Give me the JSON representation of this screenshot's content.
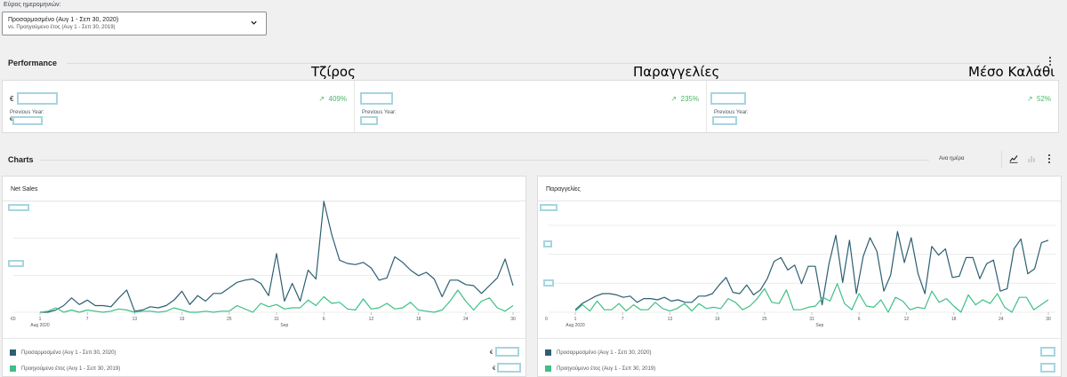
{
  "date_range": {
    "label": "Εύρος ημερομηνιών:",
    "primary": "Προσαρμοσμένο (Αυγ 1 - Σεπ 30, 2020)",
    "secondary": "vs. Προηγούμενο έτος (Αυγ 1 - Σεπ 30, 2019)",
    "icon": "chevron-down-icon"
  },
  "performance": {
    "title": "Performance",
    "menu_icon": "kebab-menu-icon",
    "overlays": [
      "Τζίρος",
      "Παραγγελίες",
      "Μέσο Καλάθι"
    ],
    "cards": [
      {
        "currency": "€",
        "delta": "409%",
        "previous_label": "Previous Year:",
        "previous_currency": "€"
      },
      {
        "currency": "",
        "delta": "235%",
        "previous_label": "Previous Year:",
        "previous_currency": ""
      },
      {
        "currency": "",
        "delta": "52%",
        "previous_label": "Previous Year:",
        "previous_currency": ""
      }
    ],
    "delta_color": "#4ab866",
    "delta_icon": "arrow-up-right-icon"
  },
  "charts": {
    "title": "Charts",
    "interval_label": "Ανα ημέρα",
    "icons": [
      "line-chart-icon",
      "bar-chart-icon",
      "kebab-menu-icon"
    ],
    "x_ticks": [
      "1",
      "7",
      "13",
      "19",
      "25",
      "31",
      "6",
      "12",
      "18",
      "24",
      "30"
    ],
    "month_labels": [
      "Aug 2020",
      "Sep"
    ],
    "colors": {
      "current": "#2c5f72",
      "previous": "#3fbf86"
    },
    "legend": {
      "current": "Προσαρμοσμένο (Αυγ 1 - Σεπ 30, 2020)",
      "previous": "Προηγούμενο έτος (Αυγ 1 - Σεπ 30, 2019)"
    }
  },
  "chart_data": [
    {
      "type": "line",
      "title": "Net Sales",
      "x_range": [
        "2020-08-01",
        "2020-09-30"
      ],
      "y_tick_labels": [
        "€0"
      ],
      "series": [
        {
          "name": "Προσαρμοσμένο (Αυγ 1 - Σεπ 30, 2020)",
          "values": [
            0,
            0,
            2,
            6,
            13,
            7,
            11,
            6,
            6,
            5,
            13,
            20,
            1,
            2,
            5,
            4,
            6,
            11,
            19,
            7,
            15,
            10,
            17,
            17,
            22,
            27,
            29,
            30,
            26,
            15,
            53,
            10,
            26,
            10,
            38,
            30,
            100,
            70,
            47,
            44,
            43,
            45,
            40,
            29,
            31,
            50,
            45,
            38,
            33,
            36,
            30,
            14,
            29,
            29,
            25,
            24,
            17,
            24,
            31,
            48,
            24
          ],
          "color": "#2c5f72"
        },
        {
          "name": "Προηγούμενο έτος (Αυγ 1 - Σεπ 30, 2019)",
          "values": [
            0,
            1,
            4,
            0,
            2,
            0,
            2,
            1,
            0,
            1,
            3,
            2,
            0,
            1,
            1,
            0,
            1,
            4,
            2,
            0,
            0,
            1,
            0,
            1,
            1,
            6,
            3,
            0,
            8,
            5,
            7,
            3,
            4,
            4,
            11,
            6,
            14,
            8,
            9,
            3,
            2,
            12,
            3,
            4,
            8,
            3,
            4,
            9,
            2,
            1,
            0,
            2,
            10,
            20,
            10,
            2,
            10,
            13,
            4,
            1,
            6
          ],
          "color": "#3fbf86"
        }
      ]
    },
    {
      "type": "line",
      "title": "Παραγγελίες",
      "x_range": [
        "2020-08-01",
        "2020-09-30"
      ],
      "y_tick_labels": [
        "0"
      ],
      "series": [
        {
          "name": "Προσαρμοσμένο (Αυγ 1 - Σεπ 30, 2020)",
          "values": [
            2,
            7,
            10,
            13,
            15,
            15,
            14,
            12,
            13,
            8,
            11,
            11,
            10,
            12,
            9,
            10,
            8,
            8,
            13,
            13,
            15,
            22,
            28,
            16,
            15,
            22,
            14,
            18,
            27,
            41,
            44,
            34,
            38,
            23,
            37,
            37,
            6,
            39,
            62,
            24,
            58,
            15,
            45,
            60,
            49,
            17,
            30,
            65,
            40,
            60,
            31,
            15,
            53,
            46,
            51,
            28,
            29,
            44,
            44,
            27,
            39,
            42,
            17,
            19,
            51,
            59,
            31,
            35,
            56,
            58
          ],
          "color": "#2c5f72"
        },
        {
          "name": "Προηγούμενο έτος (Αυγ 1 - Σεπ 30, 2019)",
          "values": [
            1,
            6,
            1,
            9,
            2,
            2,
            7,
            1,
            6,
            2,
            2,
            8,
            3,
            1,
            3,
            7,
            1,
            7,
            3,
            4,
            3,
            11,
            8,
            2,
            5,
            11,
            19,
            8,
            7,
            18,
            2,
            2,
            4,
            5,
            12,
            9,
            23,
            7,
            2,
            15,
            5,
            4,
            10,
            0,
            12,
            9,
            2,
            4,
            3,
            17,
            8,
            11,
            5,
            0,
            14,
            6,
            10,
            7,
            15,
            4,
            0,
            12,
            12,
            2,
            6,
            10
          ],
          "color": "#3fbf86"
        }
      ]
    }
  ]
}
